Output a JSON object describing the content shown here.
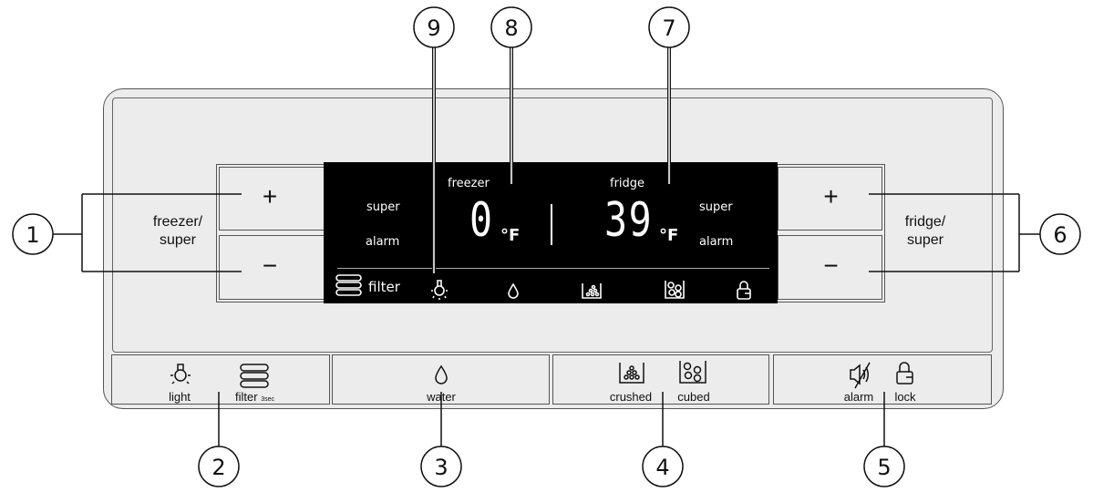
{
  "left_group": {
    "label_line1": "freezer/",
    "label_line2": "super",
    "plus": "+",
    "minus": "−"
  },
  "right_group": {
    "label_line1": "fridge/",
    "label_line2": "super",
    "plus": "+",
    "minus": "−"
  },
  "display": {
    "freezer_label": "freezer",
    "freezer_temp": "0",
    "freezer_unit": "°F",
    "fridge_label": "fridge",
    "fridge_temp": "39",
    "fridge_unit": "°F",
    "left_super": "super",
    "left_alarm": "alarm",
    "right_super": "super",
    "right_alarm": "alarm",
    "filter_label": "filter",
    "icons": [
      "filter-icon",
      "light-icon",
      "water-drop-icon",
      "crushed-ice-icon",
      "cubed-ice-icon",
      "lock-icon"
    ]
  },
  "bottom_buttons": {
    "light": "light",
    "filter": "filter",
    "filter_hint": "3sec",
    "water": "water",
    "crushed": "crushed",
    "cubed": "cubed",
    "alarm": "alarm",
    "lock": "lock"
  },
  "callouts": [
    "1",
    "2",
    "3",
    "4",
    "5",
    "6",
    "7",
    "8",
    "9"
  ]
}
